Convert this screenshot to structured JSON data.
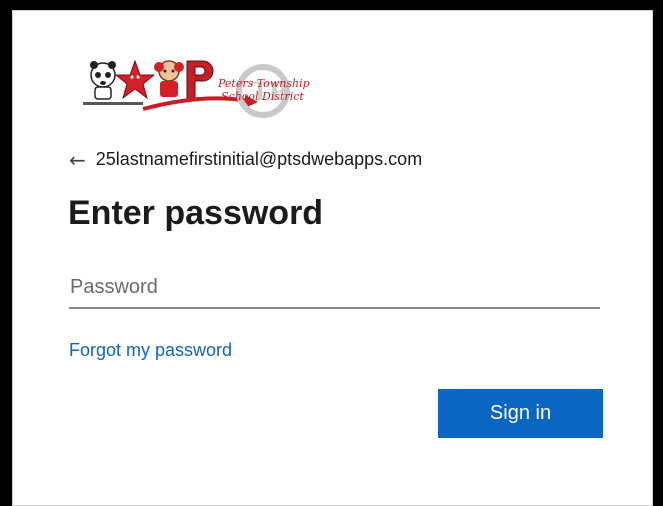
{
  "logo": {
    "line1": "Peters Township",
    "line2": "School District"
  },
  "account": {
    "back_icon": "left-arrow-icon",
    "email": "25lastnamefirstinitial@ptsdwebapps.com"
  },
  "heading": "Enter password",
  "password_field": {
    "placeholder": "Password",
    "value": ""
  },
  "forgot_link": "Forgot my password",
  "signin_button": "Sign in",
  "colors": {
    "accent": "#0b66c2",
    "text": "#1b1b1b"
  }
}
